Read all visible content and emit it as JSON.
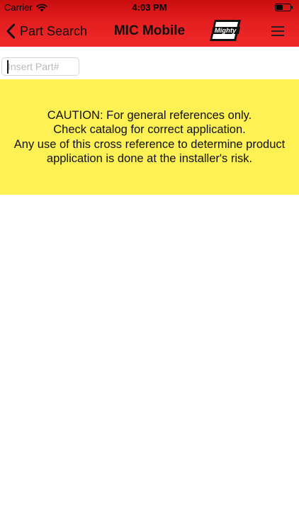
{
  "status_bar": {
    "carrier": "Carrier",
    "time": "4:03 PM",
    "wifi_icon": "wifi-icon",
    "battery_icon": "battery-icon"
  },
  "nav": {
    "back_label": "Part Search",
    "title": "MIC Mobile",
    "logo_text": "Mighty",
    "back_icon": "chevron-left-icon",
    "menu_icon": "hamburger-menu-icon"
  },
  "search": {
    "placeholder": "Insert Part#",
    "value": ""
  },
  "caution": {
    "lines": [
      "CAUTION: For general references only.",
      "Check catalog for correct application.",
      "Any use of this cross reference to determine product",
      "application is done at the installer's risk."
    ]
  },
  "colors": {
    "header_red": "#e41e1f",
    "caution_yellow": "#fef154",
    "background": "#ffffff"
  }
}
